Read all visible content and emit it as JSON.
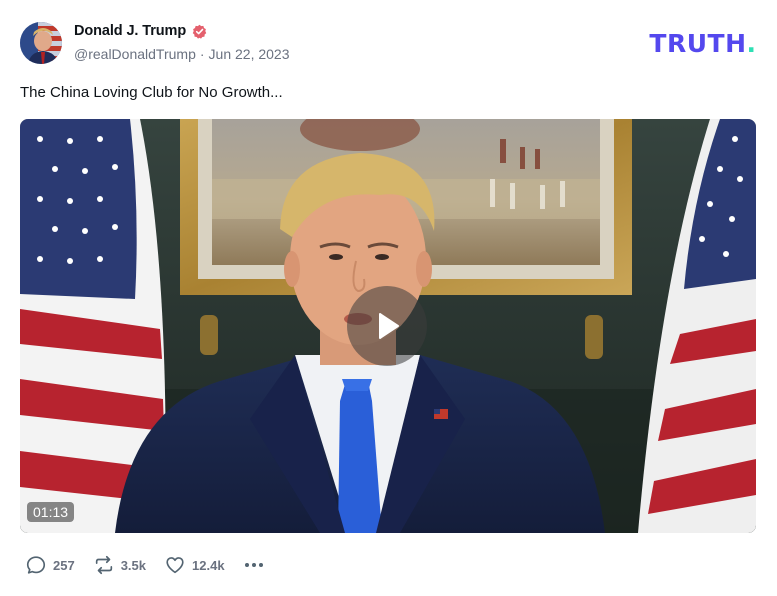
{
  "author": {
    "display_name": "Donald J. Trump",
    "handle": "@realDonaldTrump",
    "date": "Jun 22, 2023",
    "verified_color": "#e4606d"
  },
  "brand": {
    "name": "TRUTH",
    "dot": ".",
    "color": "#5448ee",
    "dot_color": "#2ee0b4"
  },
  "post": {
    "text": "The China Loving Club for No Growth..."
  },
  "video": {
    "duration": "01:13",
    "play_icon": "play-icon"
  },
  "actions": {
    "replies": "257",
    "retruths": "3.5k",
    "likes": "12.4k"
  }
}
